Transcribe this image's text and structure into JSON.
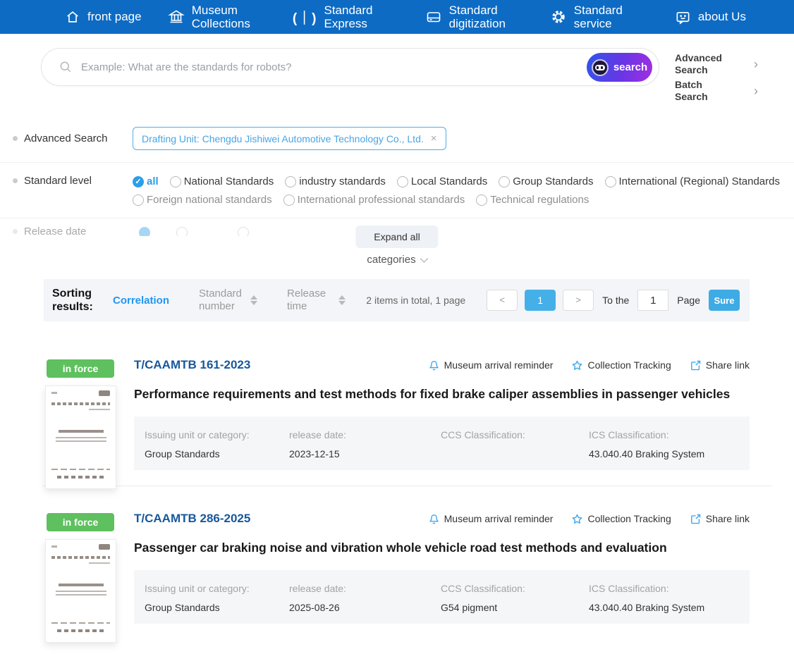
{
  "nav": {
    "items": [
      {
        "icon": "home-icon",
        "label": "front page"
      },
      {
        "icon": "museum-icon",
        "label": "Museum Collections"
      },
      {
        "icon": "express-icon",
        "label": "Standard Express"
      },
      {
        "icon": "digitization-icon",
        "label": "Standard digitization"
      },
      {
        "icon": "service-gear-icon",
        "label": "Standard service"
      },
      {
        "icon": "about-chat-icon",
        "label": "about Us"
      }
    ]
  },
  "search": {
    "placeholder": "Example: What are the standards for robots?",
    "button_label": "search",
    "advanced_link": "Advanced Search",
    "batch_link": "Batch Search"
  },
  "filters": {
    "advanced_label": "Advanced Search",
    "tag": "Drafting Unit: Chengdu Jishiwei Automotive Technology Co., Ltd.",
    "tag_close": "×",
    "standard_level_label": "Standard level",
    "selected_level": "all",
    "levels_row1": [
      "all",
      "National Standards",
      "industry standards",
      "Local Standards",
      "Group Standards",
      "International (Regional) Standards"
    ],
    "levels_row2": [
      "Foreign national standards",
      "International professional standards",
      "Technical regulations"
    ],
    "collapsed_row_label": "Release date",
    "expand_all": "Expand all",
    "categories": "categories"
  },
  "sorting": {
    "label": "Sorting results:",
    "correlation": "Correlation",
    "standard_number": "Standard number",
    "release_time": "Release time",
    "total": "2 items in total, 1 page",
    "prev": "<",
    "current_page": "1",
    "next": ">",
    "to_the": "To the",
    "goto_value": "1",
    "page_word": "Page",
    "sure": "Sure"
  },
  "results": [
    {
      "status": "in force",
      "number": "T/CAAMTB 161-2023",
      "title": "Performance requirements and test methods for fixed brake caliper assemblies in passenger vehicles",
      "actions": [
        "Museum arrival reminder",
        "Collection Tracking",
        "Share link"
      ],
      "fields": [
        {
          "label": "Issuing unit or category:",
          "value": "Group Standards"
        },
        {
          "label": "release date:",
          "value": "2023-12-15"
        },
        {
          "label": "CCS Classification:",
          "value": ""
        },
        {
          "label": "ICS Classification:",
          "value": "43.040.40 Braking System"
        }
      ]
    },
    {
      "status": "in force",
      "number": "T/CAAMTB 286-2025",
      "title": "Passenger car braking noise and vibration whole vehicle road test methods and evaluation",
      "actions": [
        "Museum arrival reminder",
        "Collection Tracking",
        "Share link"
      ],
      "fields": [
        {
          "label": "Issuing unit or category:",
          "value": "Group Standards"
        },
        {
          "label": "release date:",
          "value": "2025-08-26"
        },
        {
          "label": "CCS Classification:",
          "value": "G54 pigment"
        },
        {
          "label": "ICS Classification:",
          "value": "43.040.40 Braking System"
        }
      ]
    }
  ],
  "colors": {
    "nav_blue": "#0d6bc4",
    "accent_blue": "#45b0e8",
    "correlation_blue": "#2196f3",
    "badge_green": "#5ec05e",
    "number_blue": "#17579c",
    "tag_blue": "#4aa4e4",
    "button_gradient_start": "#2f55e8",
    "button_gradient_end": "#a12fe0",
    "action_icon_blue": "#3fa8ef"
  }
}
